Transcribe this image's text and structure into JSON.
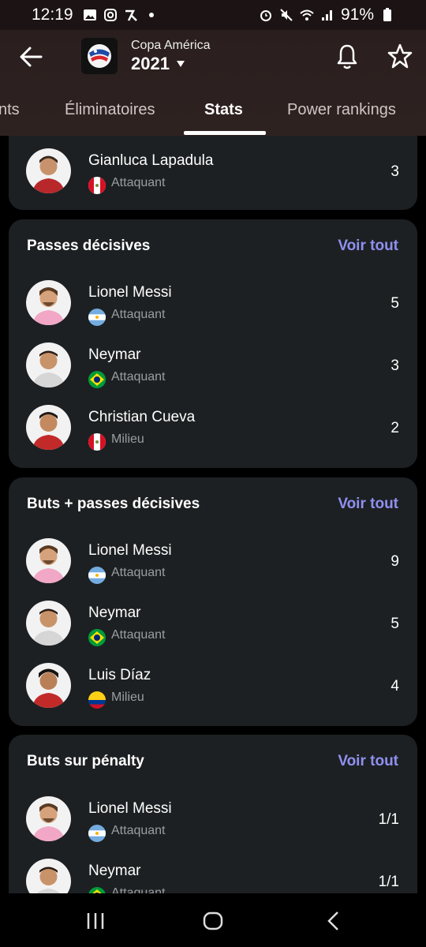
{
  "status": {
    "time": "12:19",
    "battery": "91%"
  },
  "header": {
    "competition": "Copa América",
    "season": "2021",
    "tabs": [
      "nts",
      "Éliminatoires",
      "Stats",
      "Power rankings"
    ],
    "active_tab": "Stats"
  },
  "cards": [
    {
      "title": "",
      "rows": [
        {
          "name": "Gianluca Lapadula",
          "flag": "peru",
          "position": "Attaquant",
          "value": "3",
          "jersey": "#b8282b"
        }
      ]
    },
    {
      "title": "Passes décisives",
      "link": "Voir tout",
      "rows": [
        {
          "name": "Lionel Messi",
          "flag": "argentina",
          "position": "Attaquant",
          "value": "5",
          "jersey": "#f1a7c5"
        },
        {
          "name": "Neymar",
          "flag": "brazil",
          "position": "Attaquant",
          "value": "3",
          "jersey": "#d6d6d6"
        },
        {
          "name": "Christian Cueva",
          "flag": "peru",
          "position": "Milieu",
          "value": "2",
          "jersey": "#c22a2a"
        }
      ]
    },
    {
      "title": "Buts + passes décisives",
      "link": "Voir tout",
      "rows": [
        {
          "name": "Lionel Messi",
          "flag": "argentina",
          "position": "Attaquant",
          "value": "9",
          "jersey": "#f1a7c5"
        },
        {
          "name": "Neymar",
          "flag": "brazil",
          "position": "Attaquant",
          "value": "5",
          "jersey": "#d6d6d6"
        },
        {
          "name": "Luis Díaz",
          "flag": "colombia",
          "position": "Milieu",
          "value": "4",
          "jersey": "#c22a2a"
        }
      ]
    },
    {
      "title": "Buts sur pénalty",
      "link": "Voir tout",
      "rows": [
        {
          "name": "Lionel Messi",
          "flag": "argentina",
          "position": "Attaquant",
          "value": "1/1",
          "jersey": "#f1a7c5"
        },
        {
          "name": "Neymar",
          "flag": "brazil",
          "position": "Attaquant",
          "value": "1/1",
          "jersey": "#d6d6d6"
        }
      ]
    }
  ],
  "colors": {
    "accent": "#8f90f0",
    "card": "#1d2022",
    "header": "#2e2221"
  }
}
